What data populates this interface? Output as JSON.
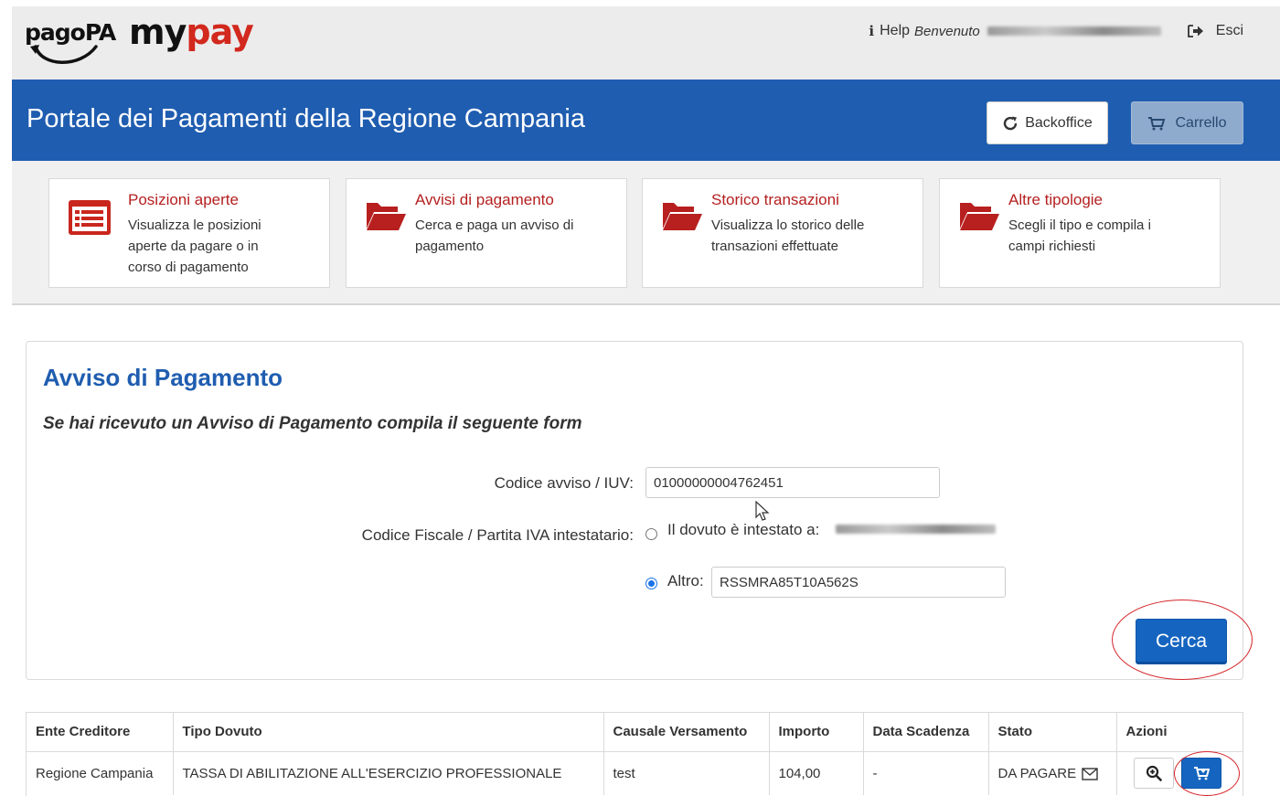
{
  "topbar": {
    "logo_pagopa": "pagoPA",
    "logo_my": "my",
    "logo_pay": "pay",
    "help_label": "Help",
    "welcome_label": "Benvenuto",
    "signout_label": "Esci"
  },
  "header": {
    "title": "Portale dei Pagamenti della Regione Campania",
    "backoffice_label": "Backoffice",
    "carrello_label": "Carrello"
  },
  "nav_cards": [
    {
      "title": "Posizioni aperte",
      "desc": "Visualizza le posizioni aperte da pagare o in corso di pagamento",
      "icon": "list-icon"
    },
    {
      "title": "Avvisi di pagamento",
      "desc": "Cerca e paga un avviso di pagamento",
      "icon": "folder-open-icon"
    },
    {
      "title": "Storico transazioni",
      "desc": "Visualizza lo storico delle transazioni effettuate",
      "icon": "folder-open-icon"
    },
    {
      "title": "Altre tipologie",
      "desc": "Scegli il tipo e compila i campi richiesti",
      "icon": "folder-open-icon"
    }
  ],
  "form": {
    "title": "Avviso di Pagamento",
    "subtitle": "Se hai ricevuto un Avviso di Pagamento compila il seguente form",
    "codice_avviso_label": "Codice avviso / IUV:",
    "codice_avviso_value": "01000000004762451",
    "codice_fiscale_label": "Codice Fiscale / Partita IVA intestatario:",
    "option_intestato_label": "Il dovuto è intestato a:",
    "option_altro_label": "Altro:",
    "altro_value": "RSSMRA85T10A562S",
    "selected_option": "Altro",
    "search_label": "Cerca"
  },
  "results": {
    "columns": [
      "Ente Creditore",
      "Tipo Dovuto",
      "Causale Versamento",
      "Importo",
      "Data Scadenza",
      "Stato",
      "Azioni"
    ],
    "rows": [
      {
        "ente": "Regione Campania",
        "tipo": "TASSA DI ABILITAZIONE ALL'ESERCIZIO PROFESSIONALE",
        "causale": "test",
        "importo": "104,00",
        "scadenza": "-",
        "stato": "DA PAGARE"
      }
    ]
  },
  "colors": {
    "primary_blue": "#1f5db0",
    "accent_red": "#b52020",
    "button_blue": "#1565c0",
    "annotation_red": "#d6262b"
  }
}
